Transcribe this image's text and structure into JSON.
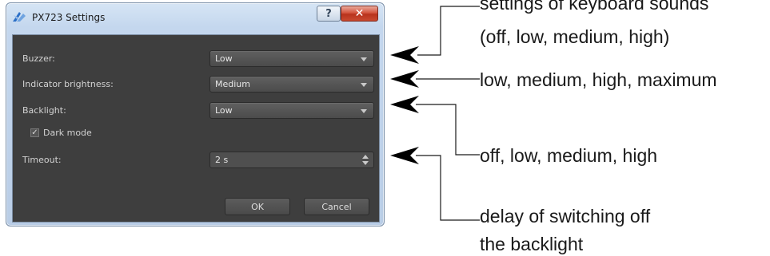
{
  "window": {
    "title": "PX723 Settings",
    "help_label": "?",
    "close_label": "✕"
  },
  "settings": {
    "buzzer": {
      "label": "Buzzer:",
      "value": "Low"
    },
    "indicator_brightness": {
      "label": "Indicator brightness:",
      "value": "Medium"
    },
    "backlight": {
      "label": "Backlight:",
      "value": "Low"
    },
    "dark_mode": {
      "label": "Dark mode",
      "checked": true,
      "check_glyph": "✓"
    },
    "timeout": {
      "label": "Timeout:",
      "value": "2 s"
    }
  },
  "buttons": {
    "ok": "OK",
    "cancel": "Cancel"
  },
  "annotations": {
    "buzzer_line1": "settings of keyboard sounds",
    "buzzer_line2": "(off, low, medium, high)",
    "indicator": "low, medium, high, maximum",
    "backlight": "off, low, medium, high",
    "timeout_line1": "delay of switching off",
    "timeout_line2": "the backlight"
  },
  "colors": {
    "dialog_background": "#3e3e3e",
    "control_background": "#555555",
    "close_button": "#c94a30",
    "app_icon_blue": "#2b6fc7"
  }
}
